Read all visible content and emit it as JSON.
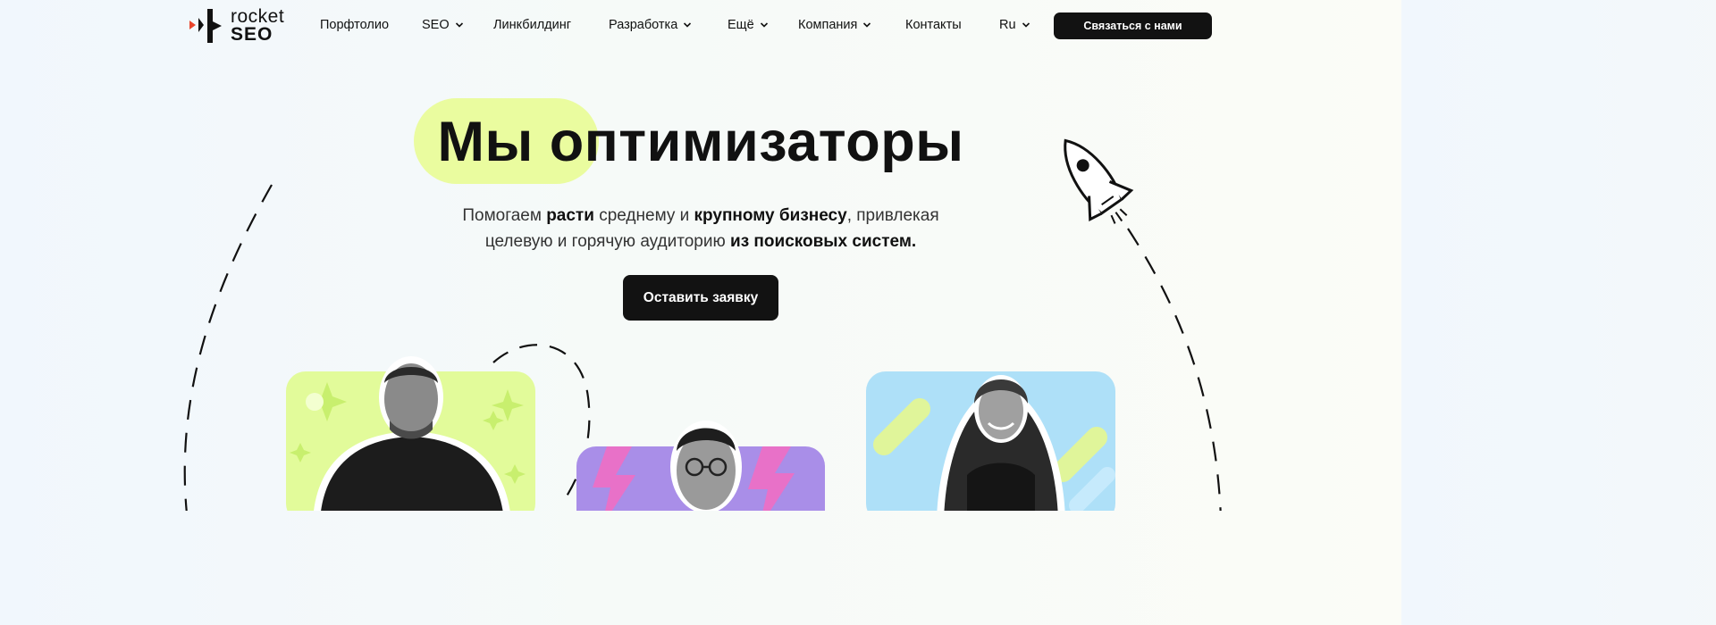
{
  "header": {
    "logo": {
      "line1": "rocket",
      "line2": "SEO"
    },
    "nav": [
      {
        "label": "Порфтолио",
        "has_dropdown": false
      },
      {
        "label": "SEO",
        "has_dropdown": true
      },
      {
        "label": "Линкбилдинг",
        "has_dropdown": false
      },
      {
        "label": "Разработка",
        "has_dropdown": true
      },
      {
        "label": "Ещё",
        "has_dropdown": true
      },
      {
        "label": "Компания",
        "has_dropdown": true
      },
      {
        "label": "Контакты",
        "has_dropdown": false
      }
    ],
    "language": {
      "label": "Ru",
      "has_dropdown": true
    },
    "contact_button": "Связаться с нами"
  },
  "hero": {
    "title": "Мы оптимизаторы",
    "subtitle": [
      {
        "text": "Помогаем ",
        "bold": false
      },
      {
        "text": "расти",
        "bold": true
      },
      {
        "text": " среднему и ",
        "bold": false
      },
      {
        "text": "крупному бизнесу",
        "bold": true
      },
      {
        "text": ", привлекая",
        "bold": false
      },
      {
        "text": "целевую и горячую аудиторию ",
        "bold": false
      },
      {
        "text": "из поисковых систем.",
        "bold": true
      }
    ],
    "cta": "Оставить заявку"
  },
  "cards": [
    {
      "name": "team-card-1",
      "color": "#e2fb9a",
      "decor": "sparkles"
    },
    {
      "name": "team-card-2",
      "color": "#a98ee8",
      "decor": "lightning"
    },
    {
      "name": "team-card-3",
      "color": "#aee0f8",
      "decor": "stripes"
    }
  ],
  "colors": {
    "accent": "#eafc9f",
    "button": "#121212",
    "logo_arrow": "#e8452c"
  },
  "icons": [
    "logo-icon",
    "chevron-down-icon",
    "rocket-icon"
  ]
}
